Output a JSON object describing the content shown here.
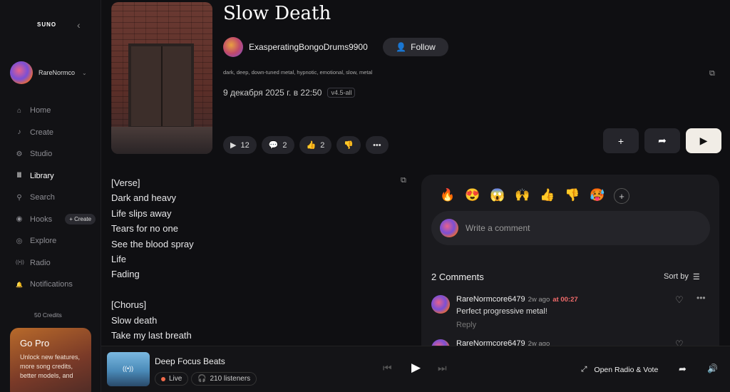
{
  "sidebar": {
    "brand": "SUNO",
    "username": "RareNormco",
    "items": [
      {
        "label": "Home",
        "icon": "⌂"
      },
      {
        "label": "Create",
        "icon": "♪"
      },
      {
        "label": "Studio",
        "icon": "⚙"
      },
      {
        "label": "Library",
        "icon": "Ⅲ"
      },
      {
        "label": "Search",
        "icon": "⚲"
      },
      {
        "label": "Hooks",
        "icon": "◉"
      },
      {
        "label": "Explore",
        "icon": "◎"
      },
      {
        "label": "Radio",
        "icon": "((•))"
      },
      {
        "label": "Notifications",
        "icon": "🔔"
      }
    ],
    "hooks_create": "+ Create",
    "credits": "50 Credits",
    "gopro_title": "Go Pro",
    "gopro_text": "Unlock new features, more song credits, better models, and"
  },
  "song": {
    "title": "Slow Death",
    "artist": "ExasperatingBongoDrums9900",
    "follow_label": "Follow",
    "tags": "dark, deep, down-tuned metal, hypnotic, emotional, slow, metal",
    "date": "9 декабря 2025 г. в 22:50",
    "version": "v4.5-all",
    "plays": "12",
    "comments": "2",
    "likes": "2"
  },
  "lyrics": "[Verse]\nDark and heavy\nLife slips away\nTears for no one\nSee the blood spray\nLife\nFading\n\n[Chorus]\nSlow death\nTake my last breath",
  "comments_panel": {
    "emojis": [
      "🔥",
      "😍",
      "😱",
      "🙌",
      "👍",
      "👎",
      "🥵"
    ],
    "placeholder": "Write a comment",
    "count_label": "2 Comments",
    "sort_label": "Sort by",
    "comments": [
      {
        "user": "RareNormcore6479",
        "ago": "2w ago",
        "at": "at 00:27",
        "text": "Perfect progressive metal!",
        "reply": "Reply"
      },
      {
        "user": "RareNormcore6479",
        "ago": "2w ago"
      }
    ]
  },
  "player": {
    "title": "Deep Focus Beats",
    "live_label": "Live",
    "listeners": "210 listeners",
    "open_radio": "Open Radio & Vote"
  }
}
